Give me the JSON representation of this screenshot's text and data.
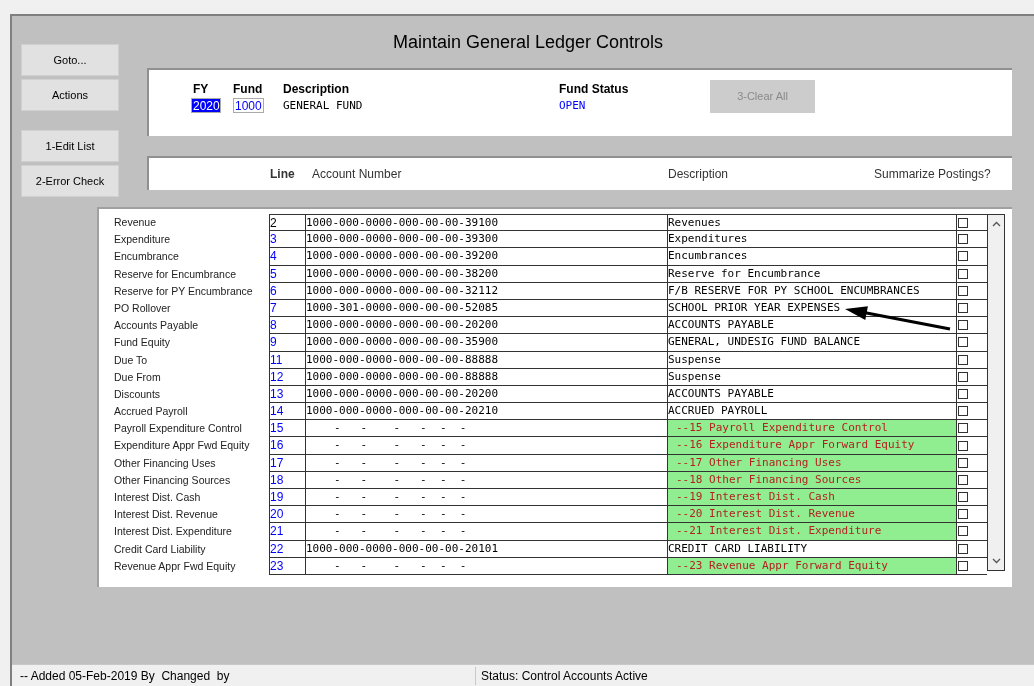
{
  "window": {
    "title": "Maintain General Ledger Controls"
  },
  "side_buttons": [
    {
      "label": "Goto..."
    },
    {
      "label": "Actions"
    },
    {
      "label": "1-Edit List"
    },
    {
      "label": "2-Error Check"
    }
  ],
  "header": {
    "fy_label": "FY",
    "fy_value": "2020",
    "fund_label": "Fund",
    "fund_value": "1000",
    "description_label": "Description",
    "description_value": "GENERAL FUND",
    "status_label": "Fund Status",
    "status_value": "OPEN",
    "clear_button": {
      "label": "3-Clear All",
      "disabled": true
    }
  },
  "columns": {
    "line": "Line",
    "account": "Account Number",
    "description": "Description",
    "summarize": "Summarize Postings?"
  },
  "rows": [
    {
      "label": "Revenue",
      "line": "2",
      "current": true,
      "account": "1000-000-0000-000-00-00-39100",
      "description": "Revenues",
      "kind": "account",
      "checked": false
    },
    {
      "label": "Expenditure",
      "line": "3",
      "current": false,
      "account": "1000-000-0000-000-00-00-39300",
      "description": "Expenditures",
      "kind": "account",
      "checked": false
    },
    {
      "label": "Encumbrance",
      "line": "4",
      "current": false,
      "account": "1000-000-0000-000-00-00-39200",
      "description": "Encumbrances",
      "kind": "account",
      "checked": false
    },
    {
      "label": "Reserve for Encumbrance",
      "line": "5",
      "current": false,
      "account": "1000-000-0000-000-00-00-38200",
      "description": "Reserve for Encumbrance",
      "kind": "account",
      "checked": false
    },
    {
      "label": "Reserve for PY Encumbrance",
      "line": "6",
      "current": false,
      "account": "1000-000-0000-000-00-00-32112",
      "description": "F/B RESERVE FOR PY SCHOOL ENCUMBRANCES",
      "kind": "account",
      "checked": false
    },
    {
      "label": "PO Rollover",
      "line": "7",
      "current": false,
      "account": "1000-301-0000-000-00-00-52085",
      "description": "SCHOOL PRIOR YEAR EXPENSES",
      "kind": "account",
      "checked": false
    },
    {
      "label": "Accounts Payable",
      "line": "8",
      "current": false,
      "account": "1000-000-0000-000-00-00-20200",
      "description": "ACCOUNTS PAYABLE",
      "kind": "account",
      "checked": false
    },
    {
      "label": "Fund Equity",
      "line": "9",
      "current": false,
      "account": "1000-000-0000-000-00-00-35900",
      "description": "GENERAL, UNDESIG FUND BALANCE",
      "kind": "account",
      "checked": false
    },
    {
      "label": "Due To",
      "line": "11",
      "current": false,
      "account": "1000-000-0000-000-00-00-88888",
      "description": "Suspense",
      "kind": "account",
      "checked": false
    },
    {
      "label": "Due From",
      "line": "12",
      "current": false,
      "account": "1000-000-0000-000-00-00-88888",
      "description": "Suspense",
      "kind": "account",
      "checked": false
    },
    {
      "label": "Discounts",
      "line": "13",
      "current": false,
      "account": "1000-000-0000-000-00-00-20200",
      "description": "ACCOUNTS PAYABLE",
      "kind": "account",
      "checked": false
    },
    {
      "label": "Accrued Payroll",
      "line": "14",
      "current": false,
      "account": "1000-000-0000-000-00-00-20210",
      "description": "ACCRUED PAYROLL",
      "kind": "account",
      "checked": false
    },
    {
      "label": "Payroll Expenditure Control",
      "line": "15",
      "current": false,
      "account": "-   -    -   -  -  -",
      "description": "--15 Payroll Expenditure Control",
      "kind": "unassigned",
      "checked": false
    },
    {
      "label": "Expenditure Appr Fwd Equity",
      "line": "16",
      "current": false,
      "account": "-   -    -   -  -  -",
      "description": "--16 Expenditure Appr Forward Equity",
      "kind": "unassigned",
      "checked": false
    },
    {
      "label": "Other Financing Uses",
      "line": "17",
      "current": false,
      "account": "-   -    -   -  -  -",
      "description": "--17 Other Financing Uses",
      "kind": "unassigned",
      "checked": false
    },
    {
      "label": "Other Financing Sources",
      "line": "18",
      "current": false,
      "account": "-   -    -   -  -  -",
      "description": "--18 Other Financing Sources",
      "kind": "unassigned",
      "checked": false
    },
    {
      "label": "Interest Dist. Cash",
      "line": "19",
      "current": false,
      "account": "-   -    -   -  -  -",
      "description": "--19 Interest Dist. Cash",
      "kind": "unassigned",
      "checked": false
    },
    {
      "label": "Interest Dist. Revenue",
      "line": "20",
      "current": false,
      "account": "-   -    -   -  -  -",
      "description": "--20 Interest Dist. Revenue",
      "kind": "unassigned",
      "checked": false
    },
    {
      "label": "Interest Dist. Expenditure",
      "line": "21",
      "current": false,
      "account": "-   -    -   -  -  -",
      "description": "--21 Interest Dist. Expenditure",
      "kind": "unassigned",
      "checked": false
    },
    {
      "label": "Credit Card Liability",
      "line": "22",
      "current": false,
      "account": "1000-000-0000-000-00-00-20101",
      "description": "CREDIT CARD LIABILITY",
      "kind": "account",
      "checked": false
    },
    {
      "label": "Revenue Appr Fwd Equity",
      "line": "23",
      "current": false,
      "account": "-   -    -   -  -  -",
      "description": "--23 Revenue Appr Forward Equity",
      "kind": "unassigned",
      "checked": false
    }
  ],
  "status_bar": {
    "left": "-- Added 05-Feb-2019 By  Changed  by",
    "status": "Status: Control Accounts Active"
  }
}
